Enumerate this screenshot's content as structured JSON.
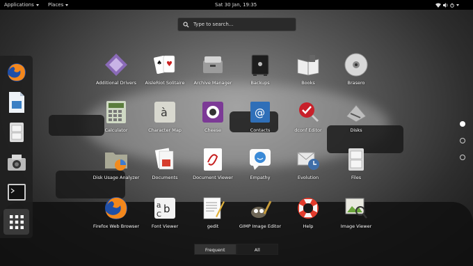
{
  "topbar": {
    "applications": "Applications",
    "places": "Places",
    "clock": "Sat 30 Jan, 19:35"
  },
  "search": {
    "placeholder": "Type to search..."
  },
  "dash_icons": [
    "firefox-icon",
    "document-writer-icon",
    "file-cabinet-icon",
    "camera-icon",
    "terminal-icon",
    "grid-icon"
  ],
  "apps": [
    "Additional Drivers",
    "AisleRiot Solitaire",
    "Archive Manager",
    "Backups",
    "Books",
    "Brasero",
    "Calculator",
    "Character Map",
    "Cheese",
    "Contacts",
    "dconf Editor",
    "Disks",
    "Disk Usage Analyzer",
    "Documents",
    "Document Viewer",
    "Empathy",
    "Evolution",
    "Files",
    "Firefox Web Browser",
    "Font Viewer",
    "gedit",
    "GIMP Image Editor",
    "Help",
    "Image Viewer"
  ],
  "pages": {
    "count": 3,
    "current": 1
  },
  "switcher": {
    "frequent": "Frequent",
    "all": "All",
    "selected": "All"
  }
}
